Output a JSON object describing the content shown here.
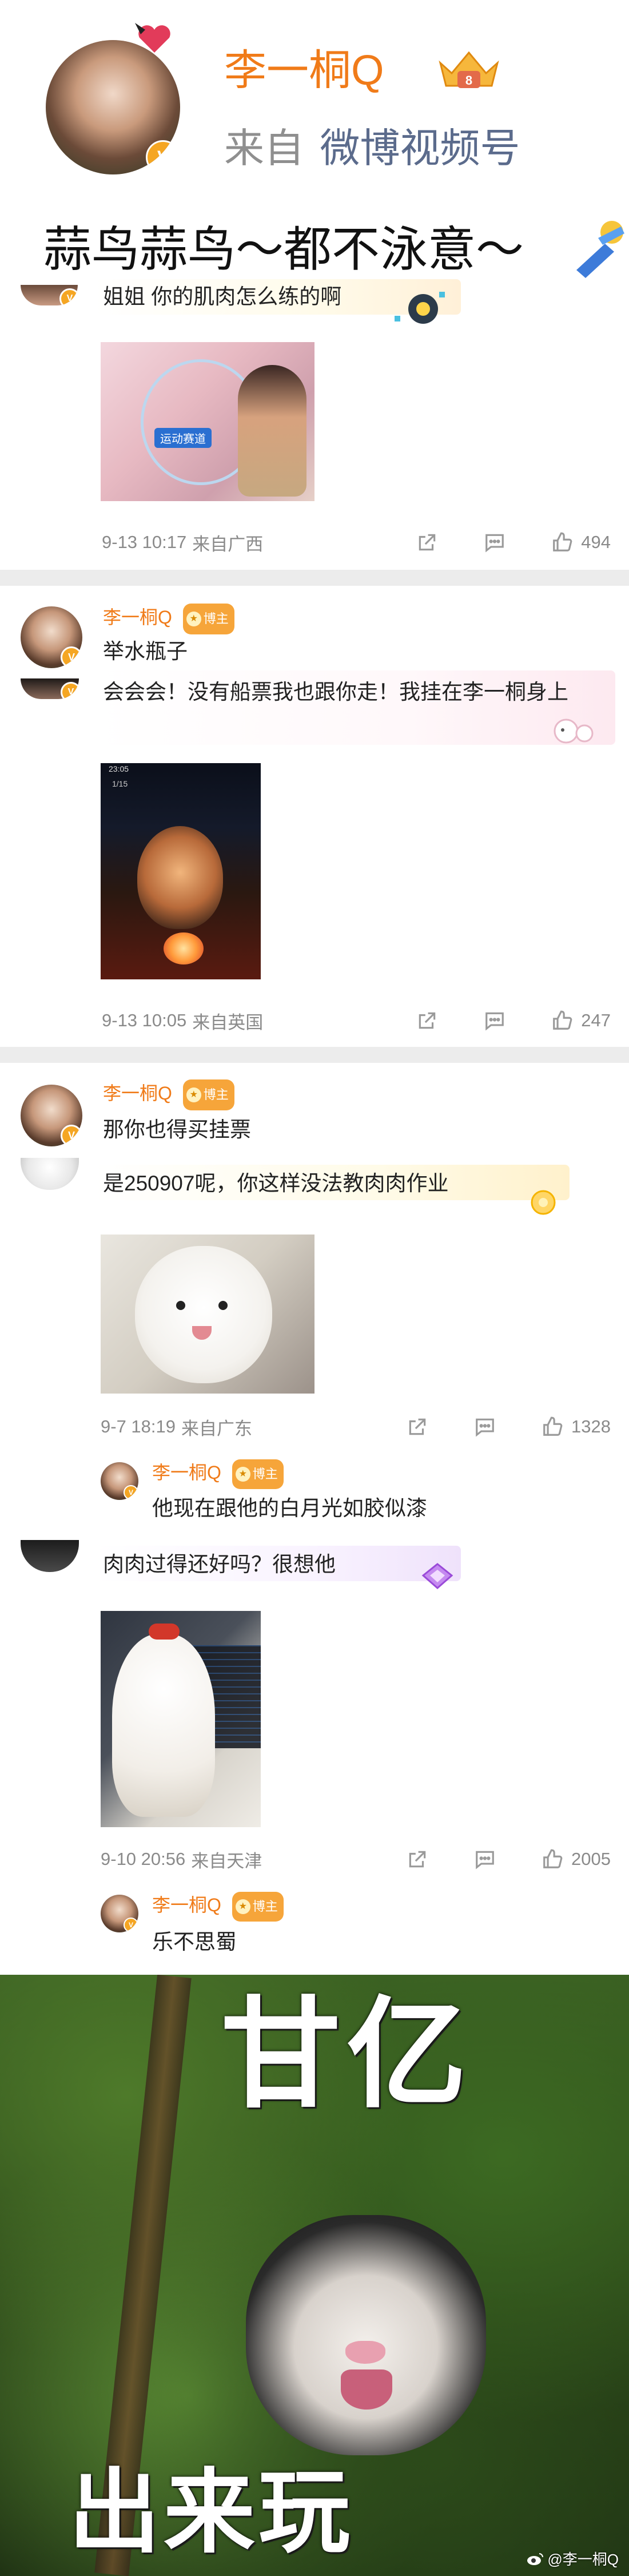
{
  "header": {
    "author_name": "李一桐Q",
    "source_prefix": "来自",
    "source_link": "微博视频号",
    "post_text": "蒜鸟蒜鸟～都不泳意～"
  },
  "comments": [
    {
      "text": "姐姐 你的肌肉怎么练的啊",
      "image_caption": "运动赛道",
      "time": "9-13 10:17",
      "location": "来自广西",
      "likes": "494"
    },
    {
      "reply_author": "李一桐Q",
      "badge": "博主",
      "reply_text": "举水瓶子",
      "text": "会会会！没有船票我也跟你走！我挂在李一桐身上",
      "image_statusbar": "23:05",
      "image_toolbar": "1/15",
      "time": "9-13 10:05",
      "location": "来自英国",
      "likes": "247"
    },
    {
      "reply_author": "李一桐Q",
      "badge": "博主",
      "reply_text": "那你也得买挂票",
      "text": "是250907呢，你这样没法教肉肉作业",
      "time": "9-7 18:19",
      "location": "来自广东",
      "likes": "1328",
      "sub_reply_author": "李一桐Q",
      "sub_badge": "博主",
      "sub_reply_text": "他现在跟他的白月光如胶似漆"
    },
    {
      "text": "肉肉过得还好吗？很想他",
      "time": "9-10 20:56",
      "location": "来自天津",
      "likes": "2005",
      "sub_reply_author": "李一桐Q",
      "sub_badge": "博主",
      "sub_reply_text": "乐不思蜀"
    }
  ],
  "meme": {
    "top_text": "甘亿",
    "bottom_text": "出来玩",
    "watermark": "@李一桐Q"
  },
  "colors": {
    "accent_orange": "#f07b19",
    "source_blue": "#5b6b8c",
    "separator": "#ececec",
    "badge": "#f6a53a"
  },
  "icons": [
    "verified-icon",
    "crown-icon",
    "share-icon",
    "comment-icon",
    "like-icon",
    "bubble-decoration-icon",
    "weibo-icon"
  ]
}
